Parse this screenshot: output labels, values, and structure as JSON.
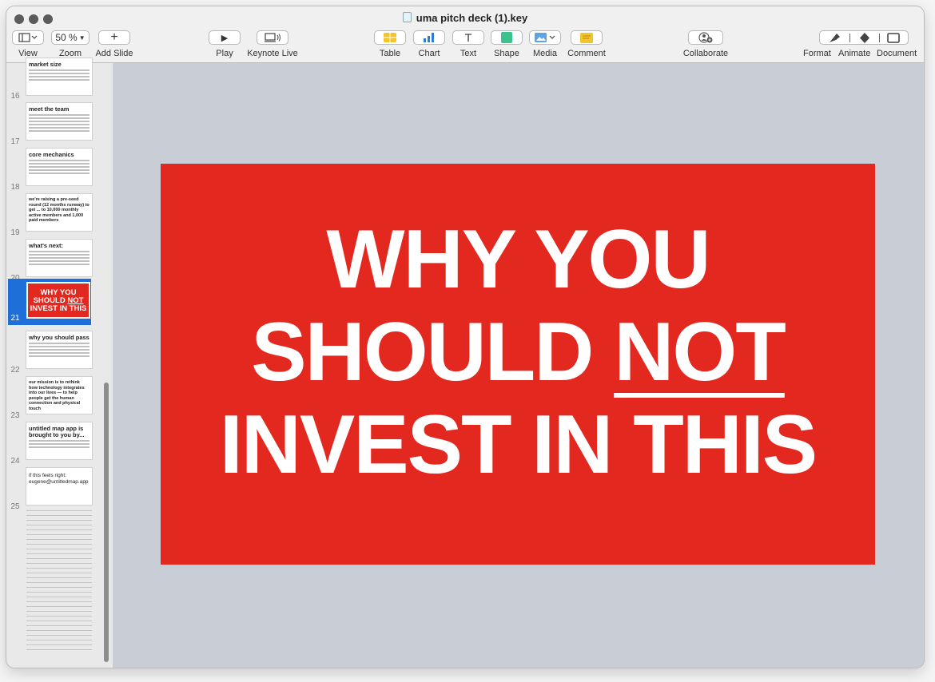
{
  "window": {
    "title": "uma pitch deck (1).key"
  },
  "toolbar": {
    "view_label": "View",
    "zoom_label": "Zoom",
    "zoom_value": "50 %",
    "add_slide_label": "Add Slide",
    "play_label": "Play",
    "keynote_live_label": "Keynote Live",
    "table_label": "Table",
    "chart_label": "Chart",
    "text_label": "Text",
    "text_glyph": "T",
    "shape_label": "Shape",
    "media_label": "Media",
    "comment_label": "Comment",
    "collaborate_label": "Collaborate",
    "format_label": "Format",
    "animate_label": "Animate",
    "document_label": "Document"
  },
  "sidebar": {
    "slides": [
      {
        "number": "16",
        "title": "market size"
      },
      {
        "number": "17",
        "title": "meet the team"
      },
      {
        "number": "18",
        "title": "core mechanics"
      },
      {
        "number": "19",
        "title": "we're raising a pre-seed round (12 months runway) to get ... to 10,000 monthly active members and 1,000 paid members"
      },
      {
        "number": "20",
        "title": "what's next:"
      },
      {
        "number": "21",
        "title_line1": "WHY YOU",
        "title_line2a": "SHOULD ",
        "title_line2b": "NOT",
        "title_line3": "INVEST IN THIS"
      },
      {
        "number": "22",
        "title": "why you should pass"
      },
      {
        "number": "23",
        "title": "our mission is to rethink how technology integrates into our lives — to help people get the human connection and physical touch"
      },
      {
        "number": "24",
        "title": "untitled map app is brought to you by..."
      },
      {
        "number": "25",
        "title": "if this feels right: eugene@untitledmap.app"
      }
    ]
  },
  "slide": {
    "line1": "WHY YOU",
    "line2a": "SHOULD ",
    "line2b": "NOT",
    "line3": "INVEST IN THIS",
    "background": "#e3281f",
    "text_color": "#ffffff"
  },
  "colors": {
    "selection": "#1e6fd9",
    "canvas": "#c9ced6"
  }
}
